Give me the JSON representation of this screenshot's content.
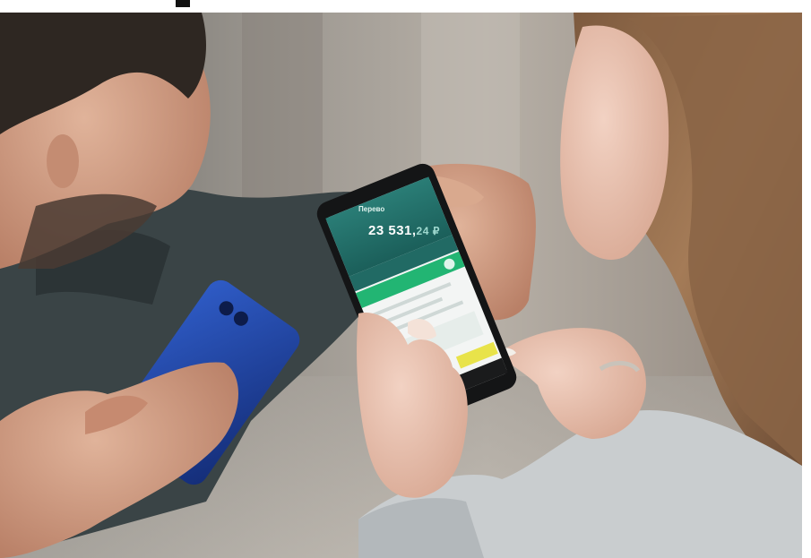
{
  "scene": {
    "caption": ""
  },
  "phone_screen": {
    "app_title": "Перево",
    "balance_main": "23 531,",
    "balance_tail": "24 ₽"
  },
  "colors": {
    "app_header": "#1f6e68",
    "app_green_bar": "#22b573",
    "app_yellow_button": "#e8e34a",
    "blue_phone": "#1c3f9b",
    "jacket": "#3d4648",
    "sweater": "#c9cdcf"
  }
}
